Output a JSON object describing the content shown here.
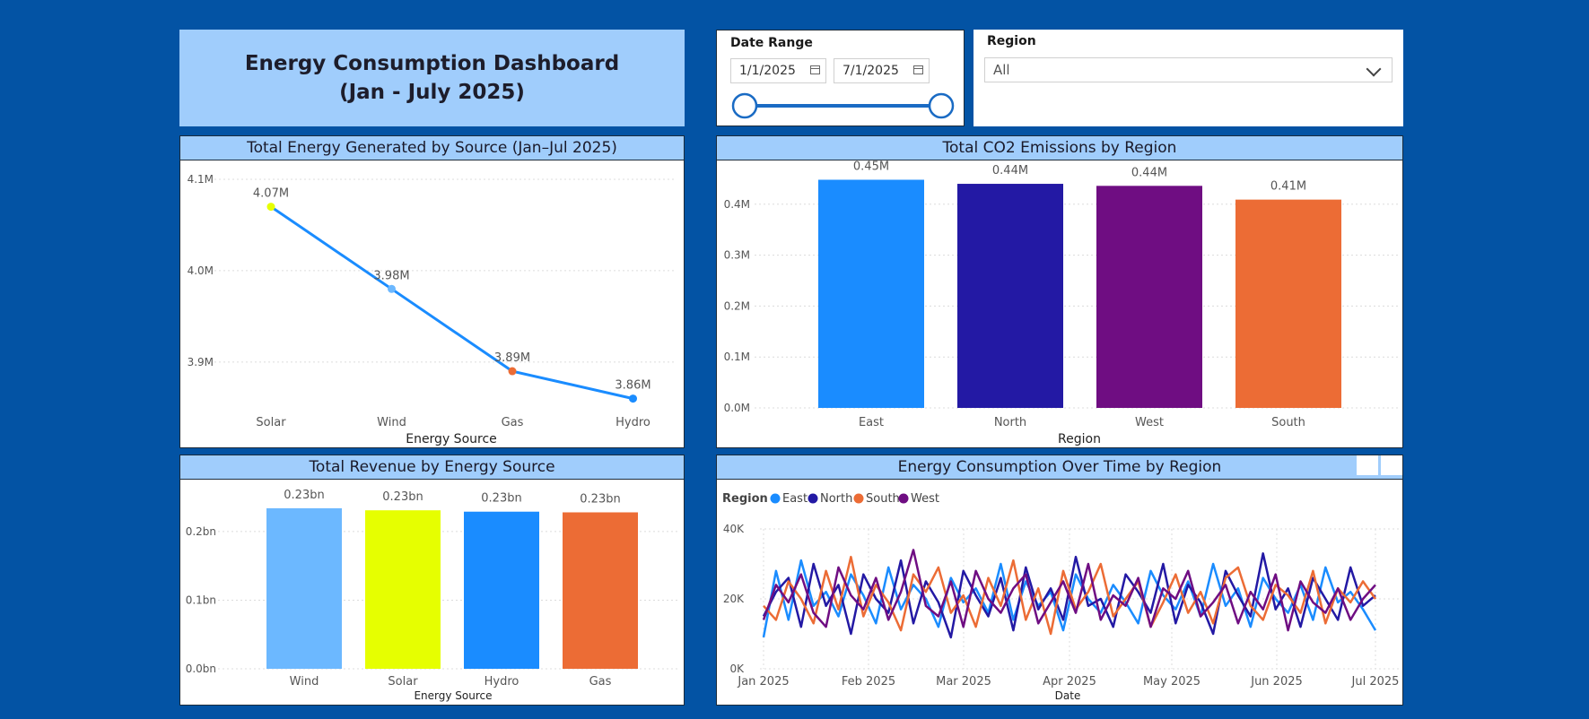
{
  "dashboard": {
    "title_line1": "Energy Consumption Dashboard",
    "title_line2": "(Jan - July 2025)"
  },
  "slicers": {
    "date_range": {
      "label": "Date Range",
      "start": "1/1/2025",
      "end": "7/1/2025"
    },
    "region": {
      "label": "Region",
      "value": "All"
    }
  },
  "colors": {
    "background": "#0353a4",
    "header": "#a0cdfc",
    "line": "#1a8cff",
    "east": "#1a8cff",
    "north": "#2319a4",
    "south": "#ec6c35",
    "west": "#6f0d82",
    "wind": "#6cb8ff",
    "solar": "#e6ff00"
  },
  "chart_data": [
    {
      "id": "energy_by_source",
      "type": "line",
      "title": "Total Energy Generated by Source (Jan–Jul 2025)",
      "xlabel": "Energy Source",
      "categories": [
        "Solar",
        "Wind",
        "Gas",
        "Hydro"
      ],
      "values": [
        4.07,
        3.98,
        3.89,
        3.86
      ],
      "data_labels": [
        "4.07M",
        "3.98M",
        "3.89M",
        "3.86M"
      ],
      "point_colors": [
        "#e6ff00",
        "#6cb8ff",
        "#ec6c35",
        "#1a8cff"
      ],
      "ylim": [
        3.84,
        4.1
      ],
      "yticks": [
        3.9,
        4.0,
        4.1
      ],
      "ytick_labels": [
        "3.9M",
        "4.0M",
        "4.1M"
      ],
      "grid": true
    },
    {
      "id": "co2_by_region",
      "type": "bar",
      "title": "Total CO2 Emissions by Region",
      "xlabel": "Region",
      "categories": [
        "East",
        "North",
        "West",
        "South"
      ],
      "values": [
        0.448,
        0.44,
        0.436,
        0.409
      ],
      "data_labels": [
        "0.45M",
        "0.44M",
        "0.44M",
        "0.41M"
      ],
      "bar_colors": [
        "#1a8cff",
        "#2319a4",
        "#6f0d82",
        "#ec6c35"
      ],
      "ylim": [
        0,
        0.47
      ],
      "yticks": [
        0,
        0.1,
        0.2,
        0.3,
        0.4
      ],
      "ytick_labels": [
        "0.0M",
        "0.1M",
        "0.2M",
        "0.3M",
        "0.4M"
      ],
      "grid": true
    },
    {
      "id": "revenue_by_source",
      "type": "bar",
      "title": "Total Revenue by Energy Source",
      "xlabel": "Energy Source",
      "categories": [
        "Wind",
        "Solar",
        "Hydro",
        "Gas"
      ],
      "values": [
        0.234,
        0.231,
        0.229,
        0.228
      ],
      "data_labels": [
        "0.23bn",
        "0.23bn",
        "0.23bn",
        "0.23bn"
      ],
      "bar_colors": [
        "#6cb8ff",
        "#e6ff00",
        "#1a8cff",
        "#ec6c35"
      ],
      "ylim": [
        0,
        0.26
      ],
      "yticks": [
        0,
        0.1,
        0.2
      ],
      "ytick_labels": [
        "0.0bn",
        "0.1bn",
        "0.2bn"
      ],
      "grid": true
    },
    {
      "id": "consumption_over_time",
      "type": "line",
      "title": "Energy Consumption Over Time by Region",
      "xlabel": "Date",
      "legend_title": "Region",
      "legend_position": "top-left",
      "x_tick_labels": [
        "Jan 2025",
        "Feb 2025",
        "Mar 2025",
        "Apr 2025",
        "May 2025",
        "Jun 2025",
        "Jul 2025"
      ],
      "x_range": [
        "2025-01-01",
        "2025-07-01"
      ],
      "ylim": [
        0,
        40000
      ],
      "yticks": [
        0,
        20000,
        40000
      ],
      "ytick_labels": [
        "0K",
        "20K",
        "40K"
      ],
      "grid": true,
      "series": [
        {
          "name": "East",
          "color": "#1a8cff",
          "values": [
            9000,
            28000,
            14000,
            31000,
            18000,
            22000,
            15000,
            27000,
            21000,
            13000,
            29000,
            17000,
            24000,
            20000,
            12000,
            26000,
            19000,
            23000,
            16000,
            30000,
            14000,
            25000,
            18000,
            22000,
            11000,
            27000,
            20000,
            16000,
            24000,
            19000,
            13000,
            28000,
            21000,
            17000,
            25000,
            15000,
            30000,
            18000,
            23000,
            12000,
            26000,
            20000,
            16000,
            24000,
            14000,
            29000,
            19000,
            22000,
            17000,
            11000
          ]
        },
        {
          "name": "North",
          "color": "#2319a4",
          "values": [
            15000,
            22000,
            26000,
            12000,
            30000,
            18000,
            24000,
            10000,
            27000,
            20000,
            16000,
            31000,
            13000,
            25000,
            19000,
            9000,
            28000,
            21000,
            15000,
            26000,
            11000,
            29000,
            17000,
            23000,
            14000,
            32000,
            18000,
            20000,
            12000,
            27000,
            22000,
            16000,
            30000,
            13000,
            24000,
            19000,
            10000,
            28000,
            21000,
            15000,
            33000,
            17000,
            23000,
            12000,
            26000,
            20000,
            14000,
            29000,
            18000,
            21000
          ]
        },
        {
          "name": "South",
          "color": "#ec6c35",
          "values": [
            18000,
            14000,
            25000,
            20000,
            13000,
            28000,
            17000,
            32000,
            15000,
            24000,
            19000,
            11000,
            27000,
            22000,
            29000,
            16000,
            21000,
            12000,
            26000,
            18000,
            31000,
            14000,
            23000,
            10000,
            28000,
            17000,
            22000,
            30000,
            15000,
            20000,
            25000,
            12000,
            19000,
            27000,
            16000,
            22000,
            13000,
            26000,
            29000,
            18000,
            14000,
            24000,
            21000,
            16000,
            28000,
            13000,
            23000,
            19000,
            25000,
            20000
          ]
        },
        {
          "name": "West",
          "color": "#6f0d82",
          "values": [
            14000,
            24000,
            19000,
            27000,
            16000,
            12000,
            29000,
            21000,
            17000,
            26000,
            14000,
            22000,
            34000,
            18000,
            15000,
            25000,
            12000,
            28000,
            20000,
            16000,
            23000,
            27000,
            13000,
            19000,
            25000,
            16000,
            30000,
            14000,
            21000,
            18000,
            26000,
            12000,
            23000,
            20000,
            28000,
            15000,
            19000,
            24000,
            13000,
            22000,
            17000,
            27000,
            11000,
            25000,
            19000,
            16000,
            23000,
            14000,
            20000,
            24000
          ]
        }
      ]
    }
  ]
}
